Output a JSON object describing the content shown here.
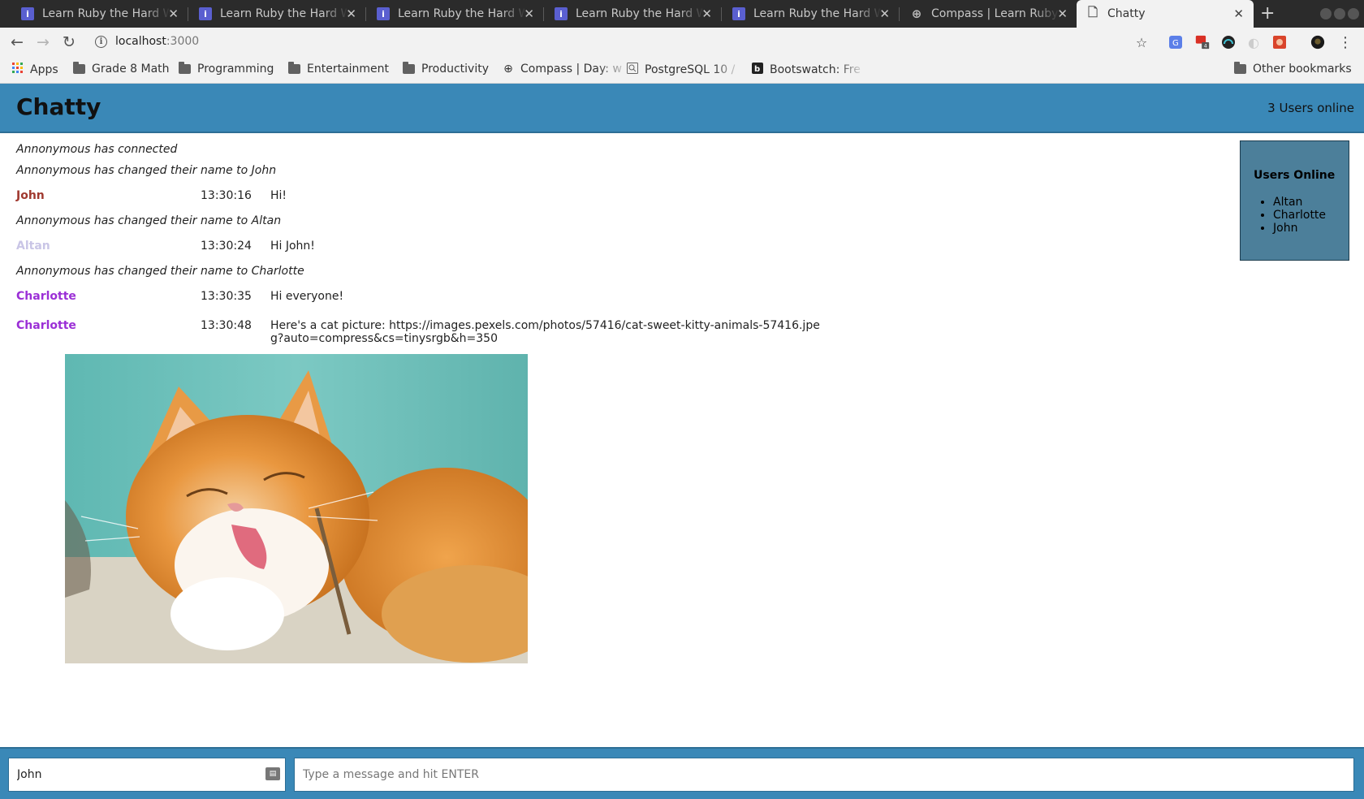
{
  "browser": {
    "tabs": [
      {
        "title": "Learn Ruby the Hard Way",
        "icon": "book-icon"
      },
      {
        "title": "Learn Ruby the Hard Way",
        "icon": "book-icon"
      },
      {
        "title": "Learn Ruby the Hard Way",
        "icon": "book-icon"
      },
      {
        "title": "Learn Ruby the Hard Way",
        "icon": "book-icon"
      },
      {
        "title": "Learn Ruby the Hard Way",
        "icon": "book-icon"
      },
      {
        "title": "Compass | Learn Ruby",
        "icon": "compass-icon"
      },
      {
        "title": "Chatty",
        "icon": "page-icon",
        "active": true
      }
    ],
    "url_host": "localhost",
    "url_port": ":3000",
    "bookmarks": [
      {
        "label": "Apps",
        "icon": "apps-grid-icon"
      },
      {
        "label": "Grade 8 Math",
        "icon": "folder-icon"
      },
      {
        "label": "Programming",
        "icon": "folder-icon"
      },
      {
        "label": "Entertainment",
        "icon": "folder-icon"
      },
      {
        "label": "Productivity",
        "icon": "folder-icon"
      },
      {
        "label": "Compass | Day: w",
        "icon": "compass-icon"
      },
      {
        "label": "PostgreSQL 10 /",
        "icon": "search-page-icon"
      },
      {
        "label": "Bootswatch: Fre",
        "icon": "bootswatch-icon"
      }
    ],
    "other_bookmarks": "Other bookmarks"
  },
  "header": {
    "brand": "Chatty",
    "users_online": "3 Users online"
  },
  "messages": {
    "sys1": "Annonymous has connected",
    "sys2": "Annonymous has changed their name to John",
    "m1": {
      "user": "John",
      "time": "13:30:16",
      "content": "Hi!",
      "color": "#a0392f"
    },
    "sys3": "Annonymous has changed their name to Altan",
    "m2": {
      "user": "Altan",
      "time": "13:30:24",
      "content": "Hi John!",
      "color": "#c9c5e6"
    },
    "sys4": "Annonymous has changed their name to Charlotte",
    "m3": {
      "user": "Charlotte",
      "time": "13:30:35",
      "content": "Hi everyone!",
      "color": "#9b2fd6"
    },
    "m4": {
      "user": "Charlotte",
      "time": "13:30:48",
      "content": "Here's a cat picture: https://images.pexels.com/photos/57416/cat-sweet-kitty-animals-57416.jpeg?auto=compress&cs=tinysrgb&h=350",
      "color": "#9b2fd6"
    }
  },
  "users_panel": {
    "title": "Users Online",
    "users": [
      "Altan",
      "Charlotte",
      "John"
    ]
  },
  "compose": {
    "name_value": "John",
    "message_placeholder": "Type a message and hit ENTER"
  },
  "colors": {
    "header_bg": "#3a88b7",
    "panel_bg": "#4c7f9a"
  }
}
